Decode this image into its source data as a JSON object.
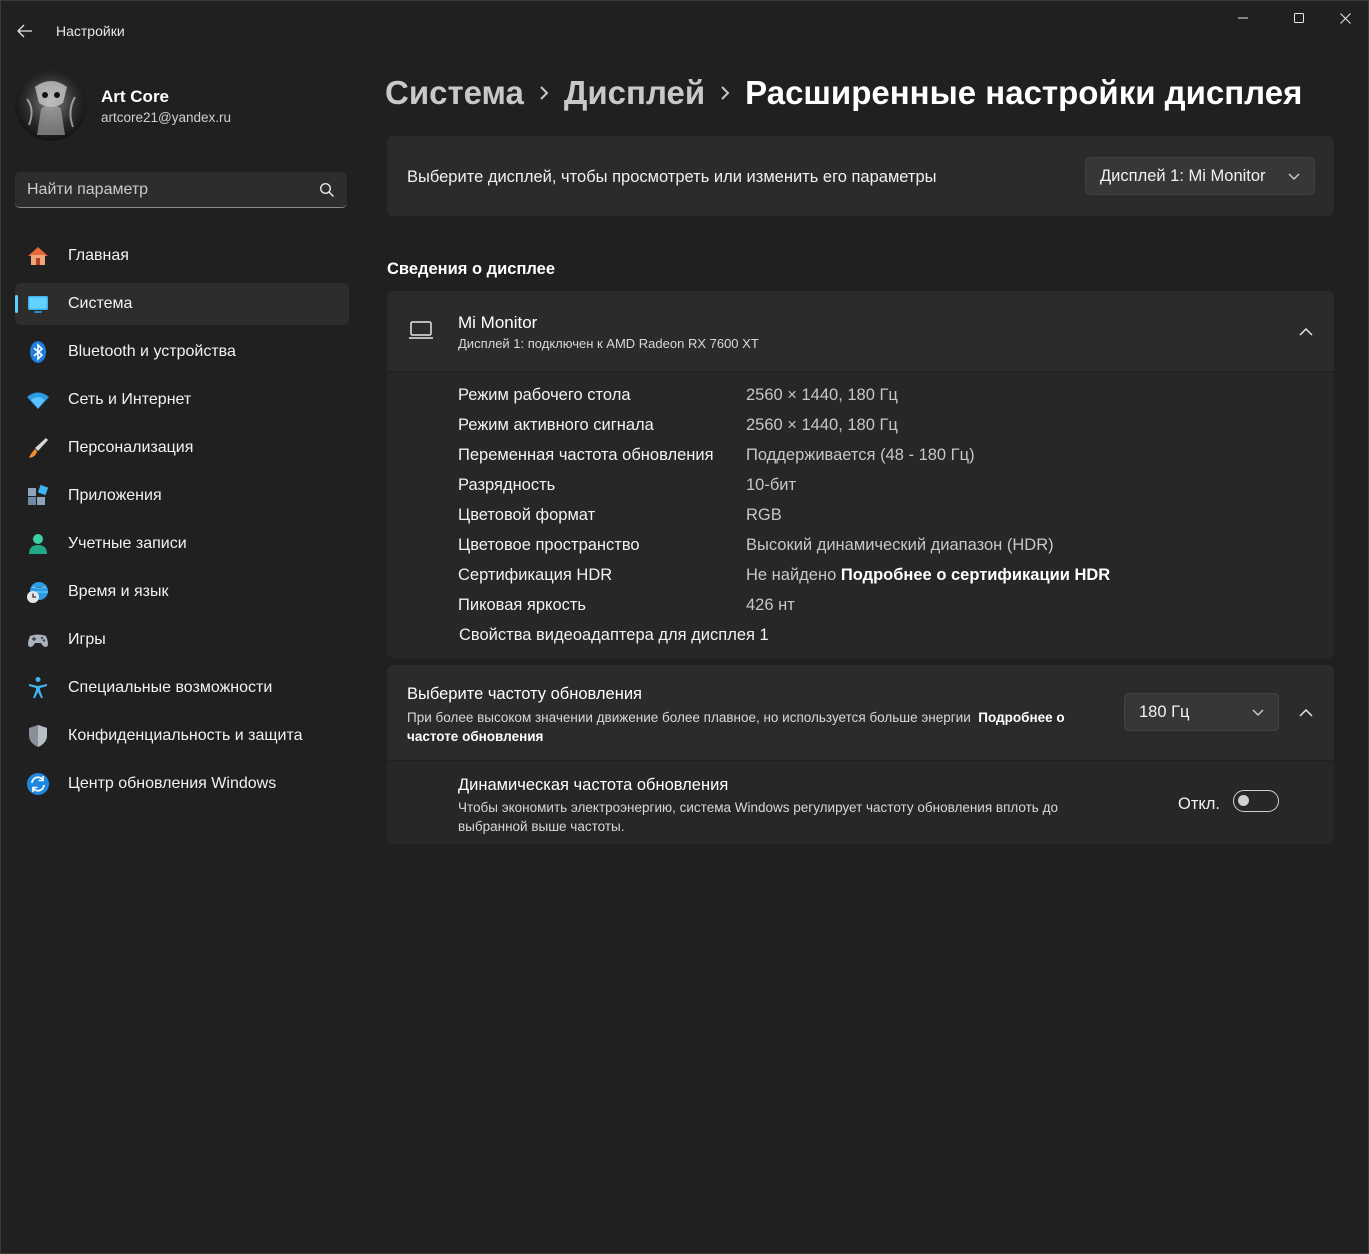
{
  "window": {
    "title": "Настройки"
  },
  "profile": {
    "name": "Art Core",
    "email": "artcore21@yandex.ru"
  },
  "search": {
    "placeholder": "Найти параметр"
  },
  "sidebar": {
    "items": [
      {
        "label": "Главная",
        "icon": "home-icon"
      },
      {
        "label": "Система",
        "icon": "system-icon",
        "active": true
      },
      {
        "label": "Bluetooth и устройства",
        "icon": "bluetooth-icon"
      },
      {
        "label": "Сеть и Интернет",
        "icon": "wifi-icon"
      },
      {
        "label": "Персонализация",
        "icon": "brush-icon"
      },
      {
        "label": "Приложения",
        "icon": "apps-icon"
      },
      {
        "label": "Учетные записи",
        "icon": "account-icon"
      },
      {
        "label": "Время и язык",
        "icon": "time-language-icon"
      },
      {
        "label": "Игры",
        "icon": "gamepad-icon"
      },
      {
        "label": "Специальные возможности",
        "icon": "accessibility-icon"
      },
      {
        "label": "Конфиденциальность и защита",
        "icon": "shield-icon"
      },
      {
        "label": "Центр обновления Windows",
        "icon": "update-icon"
      }
    ]
  },
  "breadcrumb": {
    "items": [
      "Система",
      "Дисплей",
      "Расширенные настройки дисплея"
    ]
  },
  "display_select": {
    "text": "Выберите дисплей, чтобы просмотреть или изменить его параметры",
    "value": "Дисплей 1: Mi Monitor"
  },
  "display_info": {
    "section_title": "Сведения о дисплее",
    "monitor_name": "Mi Monitor",
    "monitor_subtitle": "Дисплей 1: подключен к AMD Radeon RX 7600 XT",
    "rows": [
      {
        "key": "Режим рабочего стола",
        "value": "2560 × 1440, 180 Гц"
      },
      {
        "key": "Режим активного сигнала",
        "value": "2560 × 1440, 180 Гц"
      },
      {
        "key": "Переменная частота обновления",
        "value": "Поддерживается (48 - 180 Гц)"
      },
      {
        "key": "Разрядность",
        "value": "10-бит"
      },
      {
        "key": "Цветовой формат",
        "value": "RGB"
      },
      {
        "key": "Цветовое пространство",
        "value": "Высокий динамический диапазон (HDR)"
      },
      {
        "key": "Сертификация HDR",
        "value": "Не найдено",
        "link": "Подробнее о сертификации HDR"
      },
      {
        "key": "Пиковая яркость",
        "value": "426 нт"
      }
    ],
    "adapter_link": "Свойства видеоадаптера для дисплея 1"
  },
  "refresh_rate": {
    "title": "Выберите частоту обновления",
    "description": "При более высоком значении движение более плавное, но используется больше энергии",
    "link": "Подробнее о частоте обновления",
    "value": "180 Гц"
  },
  "dynamic_refresh": {
    "title": "Динамическая частота обновления",
    "description": "Чтобы экономить электроэнергию, система Windows регулирует частоту обновления вплоть до выбранной выше частоты.",
    "toggle_label": "Откл.",
    "enabled": false
  },
  "colors": {
    "background": "#202020",
    "card": "#2b2b2b",
    "accent": "#60cdff"
  }
}
